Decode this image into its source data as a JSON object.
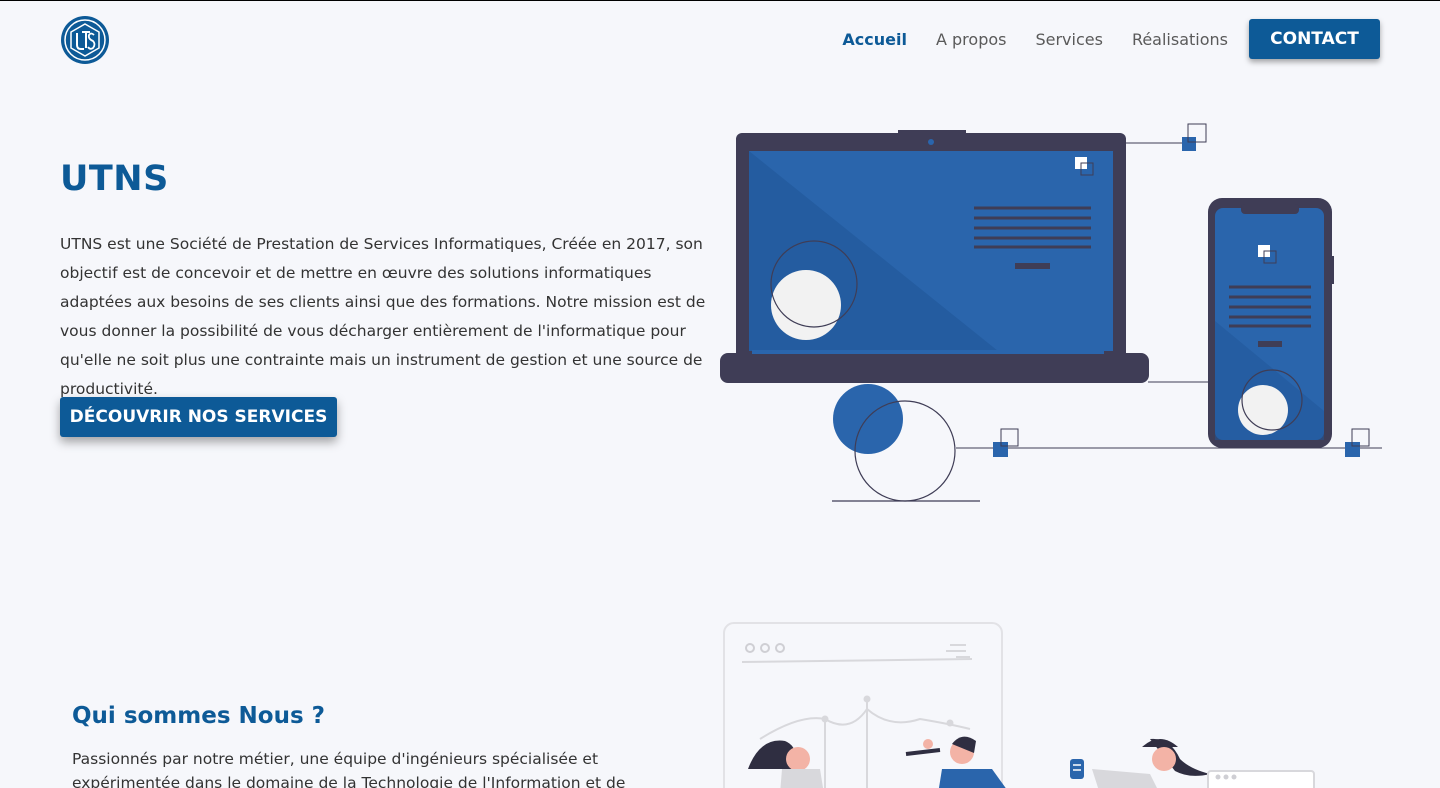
{
  "nav": {
    "logo_alt": "UTNS logo",
    "items": [
      {
        "label": "Accueil",
        "active": true
      },
      {
        "label": "A propos"
      },
      {
        "label": "Services"
      },
      {
        "label": "Réalisations"
      }
    ],
    "contact_label": "CONTACT"
  },
  "hero": {
    "title": "UTNS",
    "description": "UTNS est une Société de Prestation de Services Informatiques, Créée en 2017, son objectif est de concevoir et de mettre en œuvre des solutions informatiques adaptées aux besoins de ses clients ainsi que des formations. Notre mission est de vous donner la possibilité de vous décharger entièrement de l'informatique pour qu'elle ne soit plus une contrainte mais un instrument de gestion et une source de productivité.",
    "cta_label": "DÉCOUVRIR NOS SERVICES"
  },
  "about": {
    "title": "Qui sommes Nous ?",
    "description": "Passionnés par notre métier, une équipe d'ingénieurs spécialisée et expérimentée dans le domaine de la Technologie de l'Information et de la"
  },
  "colors": {
    "brand": "#0d5a97",
    "illustration_blue": "#2a65ac",
    "device_dark": "#3f3d56",
    "background": "#f6f7fb"
  }
}
